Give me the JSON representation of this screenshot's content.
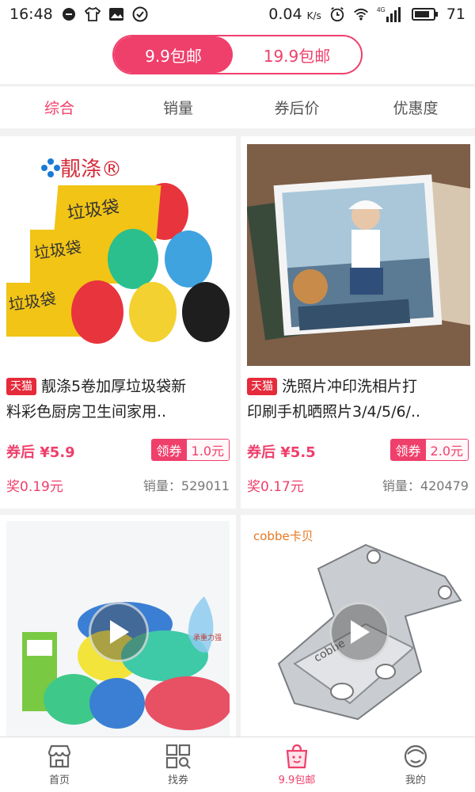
{
  "status_bar": {
    "time": "16:48",
    "speed": "0.04",
    "speed_unit": "K/s",
    "network": "4G",
    "battery": "71",
    "icons": [
      "notification-icon",
      "shirt-icon",
      "image-icon",
      "check-icon",
      "alarm-icon",
      "wifi-icon",
      "signal-icon",
      "battery-icon"
    ]
  },
  "toggle": {
    "options": [
      {
        "label": "9.9包邮",
        "active": true
      },
      {
        "label": "19.9包邮",
        "active": false
      }
    ]
  },
  "sort_tabs": [
    {
      "label": "综合",
      "active": true
    },
    {
      "label": "销量",
      "active": false
    },
    {
      "label": "券后价",
      "active": false
    },
    {
      "label": "优惠度",
      "active": false
    }
  ],
  "products": [
    {
      "brand": "靓涤®",
      "tag": "天猫",
      "title_line1": "靓涤5卷加厚垃圾袋新",
      "title_line2": "料彩色厨房卫生间家用..",
      "price": "券后 ¥5.9",
      "coupon_label": "领券",
      "coupon_value": "1.0元",
      "reward": "奖0.19元",
      "sales": "销量：529011"
    },
    {
      "tag": "天猫",
      "title_line1": "洗照片冲印洗相片打",
      "title_line2": "印刷手机晒照片3/4/5/6/..",
      "price": "券后 ¥5.5",
      "coupon_label": "领券",
      "coupon_value": "2.0元",
      "reward": "奖0.17元",
      "sales": "销量：420479"
    },
    {
      "brand_note": "承重力强"
    },
    {
      "brand": "cobbe卡贝"
    }
  ],
  "bottom_nav": [
    {
      "label": "首页",
      "icon": "store-icon",
      "active": false
    },
    {
      "label": "找券",
      "icon": "grid-search-icon",
      "active": false
    },
    {
      "label": "9.9包邮",
      "icon": "bag-icon",
      "active": true
    },
    {
      "label": "我的",
      "icon": "profile-icon",
      "active": false
    }
  ],
  "colors": {
    "accent": "#ef3f6b",
    "tmall_tag": "#e52a3a"
  }
}
